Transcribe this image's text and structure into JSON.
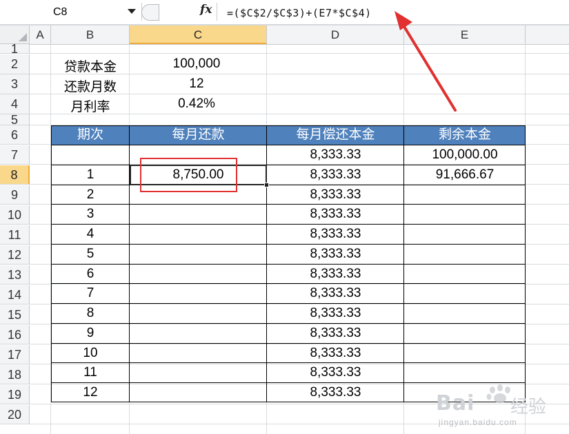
{
  "formula_bar": {
    "cell_ref": "C8",
    "fx_label": "fx",
    "formula": "=($C$2/$C$3)+(E7*$C$4)"
  },
  "columns": [
    {
      "label": "A"
    },
    {
      "label": "B"
    },
    {
      "label": "C"
    },
    {
      "label": "D"
    },
    {
      "label": "E"
    }
  ],
  "rows": [
    "1",
    "2",
    "3",
    "4",
    "5",
    "6",
    "7",
    "8",
    "9",
    "10",
    "11",
    "12",
    "13",
    "14",
    "15",
    "16",
    "17",
    "18",
    "19",
    "20"
  ],
  "info": {
    "principal_label": "贷款本金",
    "principal_value": "100,000",
    "months_label": "还款月数",
    "months_value": "12",
    "rate_label": "月利率",
    "rate_value": "0.42%"
  },
  "table": {
    "headers": [
      "期次",
      "每月还款",
      "每月偿还本金",
      "剩余本金"
    ],
    "rows": [
      {
        "period": "",
        "payment": "",
        "principal": "8,333.33",
        "remaining": "100,000.00"
      },
      {
        "period": "1",
        "payment": "8,750.00",
        "principal": "8,333.33",
        "remaining": "91,666.67"
      },
      {
        "period": "2",
        "payment": "",
        "principal": "8,333.33",
        "remaining": ""
      },
      {
        "period": "3",
        "payment": "",
        "principal": "8,333.33",
        "remaining": ""
      },
      {
        "period": "4",
        "payment": "",
        "principal": "8,333.33",
        "remaining": ""
      },
      {
        "period": "5",
        "payment": "",
        "principal": "8,333.33",
        "remaining": ""
      },
      {
        "period": "6",
        "payment": "",
        "principal": "8,333.33",
        "remaining": ""
      },
      {
        "period": "7",
        "payment": "",
        "principal": "8,333.33",
        "remaining": ""
      },
      {
        "period": "8",
        "payment": "",
        "principal": "8,333.33",
        "remaining": ""
      },
      {
        "period": "9",
        "payment": "",
        "principal": "8,333.33",
        "remaining": ""
      },
      {
        "period": "10",
        "payment": "",
        "principal": "8,333.33",
        "remaining": ""
      },
      {
        "period": "11",
        "payment": "",
        "principal": "8,333.33",
        "remaining": ""
      },
      {
        "period": "12",
        "payment": "",
        "principal": "8,333.33",
        "remaining": ""
      }
    ]
  },
  "watermark": {
    "brand": "Bai",
    "brand_cn": "经验",
    "url": "jingyan.baidu.com"
  },
  "colors": {
    "table_header_bg": "#4f81bd",
    "active_header_bg": "#f9d88c",
    "annotation_red": "#e03030"
  },
  "icons": {
    "dropdown": "chevron-down-icon",
    "formula": "fx-icon",
    "select_all": "select-all-corner-icon",
    "annotation_arrow": "red-arrow-icon"
  }
}
